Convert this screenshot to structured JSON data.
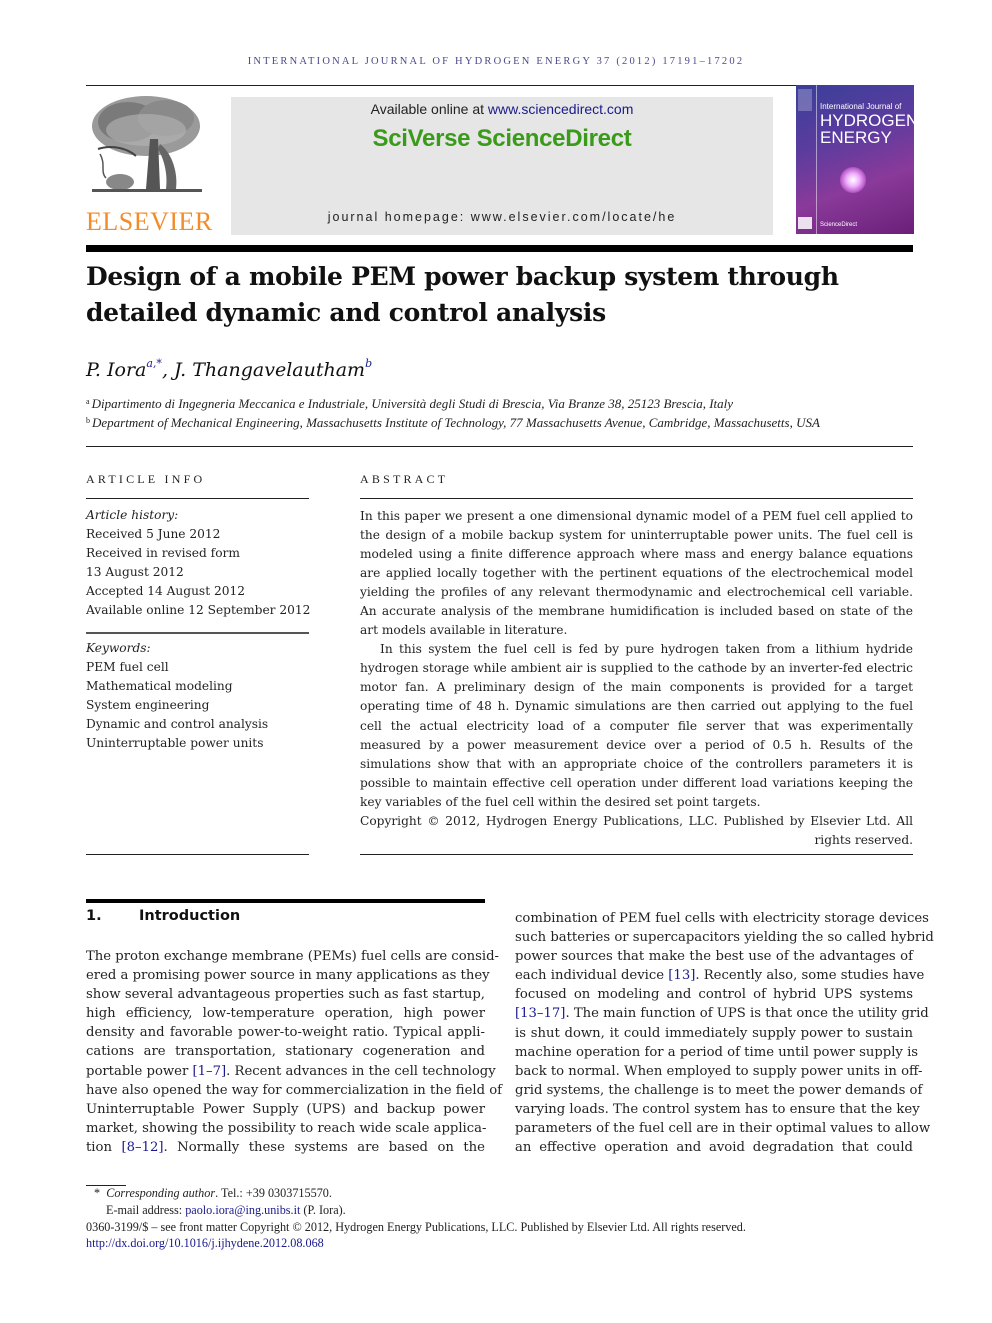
{
  "running_header": "International Journal of Hydrogen Energy 37 (2012) 17191–17202",
  "masthead": {
    "publisher_logo_text": "ELSEVIER",
    "available_prefix": "Available online at ",
    "available_link": "www.sciencedirect.com",
    "brand": "SciVerse ScienceDirect",
    "homepage": "journal homepage: www.elsevier.com/locate/he",
    "cover": {
      "line1": "International Journal of",
      "line2": "HYDROGEN",
      "line3": "ENERGY",
      "footer": "ScienceDirect"
    }
  },
  "article": {
    "title_line1": "Design of a mobile PEM power backup system through",
    "title_line2": "detailed dynamic and control analysis",
    "authors": [
      {
        "name": "P. Iora",
        "sup": "a,*"
      },
      {
        "name": "J. Thangavelautham",
        "sup": "b"
      }
    ],
    "author_separator": ", ",
    "affiliations": [
      {
        "mark": "a",
        "text": "Dipartimento di Ingegneria Meccanica e Industriale, Università degli Studi di Brescia, Via Branze 38, 25123 Brescia, Italy"
      },
      {
        "mark": "b",
        "text": "Department of Mechanical Engineering, Massachusetts Institute of Technology, 77 Massachusetts Avenue, Cambridge, Massachusetts, USA"
      }
    ]
  },
  "article_info": {
    "heading": "ARTICLE INFO",
    "history_label": "Article history:",
    "history": [
      "Received 5 June 2012",
      "Received in revised form",
      "13 August 2012",
      "Accepted 14 August 2012",
      "Available online 12 September 2012"
    ],
    "keywords_label": "Keywords:",
    "keywords": [
      "PEM fuel cell",
      "Mathematical modeling",
      "System engineering",
      "Dynamic and control analysis",
      "Uninterruptable power units"
    ]
  },
  "abstract": {
    "heading": "ABSTRACT",
    "paragraph1": "In this paper we present a one dimensional dynamic model of a PEM fuel cell applied to the design of a mobile backup system for uninterruptable power units. The fuel cell is modeled using a finite difference approach where mass and energy balance equations are applied locally together with the pertinent equations of the electrochemical model yielding the profiles of any relevant thermodynamic and electrochemical cell variable. An accurate analysis of the membrane humidification is included based on state of the art models available in literature.",
    "paragraph2": "In this system the fuel cell is fed by pure hydrogen taken from a lithium hydride hydrogen storage while ambient air is supplied to the cathode by an inverter-fed electric motor fan. A preliminary design of the main components is provided for a target operating time of 48 h. Dynamic simulations are then carried out applying to the fuel cell the actual electricity load of a computer file server that was experimentally measured by a power measurement device over a period of 0.5 h. Results of the simulations show that with an appropriate choice of the controllers parameters it is possible to maintain effective cell operation under different load variations keeping the key variables of the fuel cell within the desired set point targets.",
    "copyright": "Copyright © 2012, Hydrogen Energy Publications, LLC. Published by Elsevier Ltd. All rights reserved."
  },
  "section1": {
    "number": "1.",
    "title": "Introduction",
    "left_lines": [
      {
        "text": "The proton exchange membrane (PEMs) fuel cells are consid-"
      },
      {
        "text": "ered a promising power source in many applications as they"
      },
      {
        "text": "show several advantageous properties such as fast startup,"
      },
      {
        "text": "high efficiency, low-temperature operation, high power"
      },
      {
        "text": "density and favorable power-to-weight ratio. Typical appli-"
      },
      {
        "text": "cations are transportation, stationary cogeneration and"
      },
      {
        "pre": "portable power ",
        "cite": "[1–7]",
        "post": ". Recent advances in the cell technology"
      },
      {
        "text": "have also opened the way for commercialization in the field of"
      },
      {
        "text": "Uninterruptable Power Supply (UPS) and backup power"
      },
      {
        "text": "market, showing the possibility to reach wide scale applica-"
      },
      {
        "pre": "tion ",
        "cite": "[8–12]",
        "post": ". Normally these systems are based on the"
      }
    ],
    "right_lines": [
      {
        "text": "combination of PEM fuel cells with electricity storage devices"
      },
      {
        "text": "such batteries or supercapacitors yielding the so called hybrid"
      },
      {
        "text": "power sources that make the best use of the advantages of"
      },
      {
        "pre": "each individual device ",
        "cite": "[13]",
        "post": ". Recently also, some studies have"
      },
      {
        "text": "focused on modeling and control of hybrid UPS systems"
      },
      {
        "pre": "",
        "cite": "[13–17]",
        "post": ". The main function of UPS is that once the utility grid"
      },
      {
        "text": "is shut down, it could immediately supply power to sustain"
      },
      {
        "text": "machine operation for a period of time until power supply is"
      },
      {
        "text": "back to normal. When employed to supply power units in off-"
      },
      {
        "text": "grid systems, the challenge is to meet the power demands of"
      },
      {
        "text": "varying loads. The control system has to ensure that the key"
      },
      {
        "text": "parameters of the fuel cell are in their optimal values to allow"
      },
      {
        "text": "an effective operation and avoid degradation that could"
      }
    ]
  },
  "footnotes": {
    "corresponding_mark": "*",
    "corresponding_label": "Corresponding author",
    "tel": ". Tel.: +39 0303715570.",
    "email_label": "E-mail address: ",
    "email": "paolo.iora@ing.unibs.it",
    "email_suffix": " (P. Iora).",
    "issn_line": "0360-3199/$ – see front matter Copyright © 2012, Hydrogen Energy Publications, LLC. Published by Elsevier Ltd. All rights reserved.",
    "doi": "http://dx.doi.org/10.1016/j.ijhydene.2012.08.068"
  },
  "colors": {
    "link": "#1a1a8c",
    "elsevier_orange": "#f28c28",
    "sciencedirect_green": "#3a9a1a",
    "masthead_gray": "#e6e6e6"
  }
}
